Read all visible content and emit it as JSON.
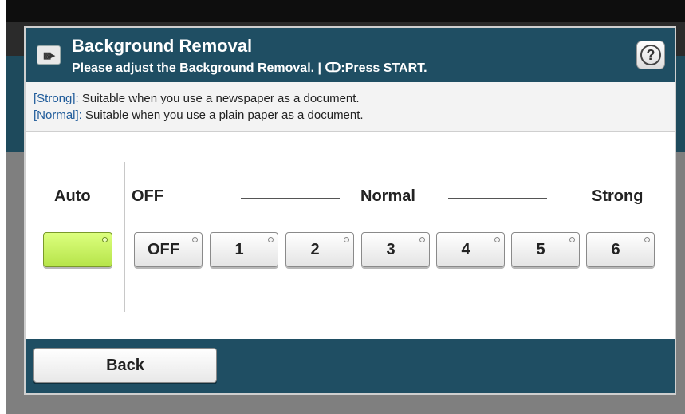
{
  "header": {
    "icon": "scan-document-icon",
    "title": "Background Removal",
    "subtitle": "Please adjust the Background Removal. | ↀ:Press START.",
    "help_label": "?"
  },
  "info": {
    "lines": [
      {
        "tag": "[Strong]:",
        "text": "  Suitable when you use a newspaper as a document."
      },
      {
        "tag": "[Normal]:",
        "text": "  Suitable when you use a plain paper as a document."
      }
    ]
  },
  "scale": {
    "auto_label": "Auto",
    "off_label": "OFF",
    "normal_label": "Normal",
    "strong_label": "Strong"
  },
  "levels": {
    "selected": "Auto",
    "options": [
      "OFF",
      "1",
      "2",
      "3",
      "4",
      "5",
      "6"
    ]
  },
  "footer": {
    "back_label": "Back"
  },
  "colors": {
    "header_bg": "#1f4e63",
    "selected_button": "#c8f05e",
    "tag_text": "#1f5b9a"
  }
}
